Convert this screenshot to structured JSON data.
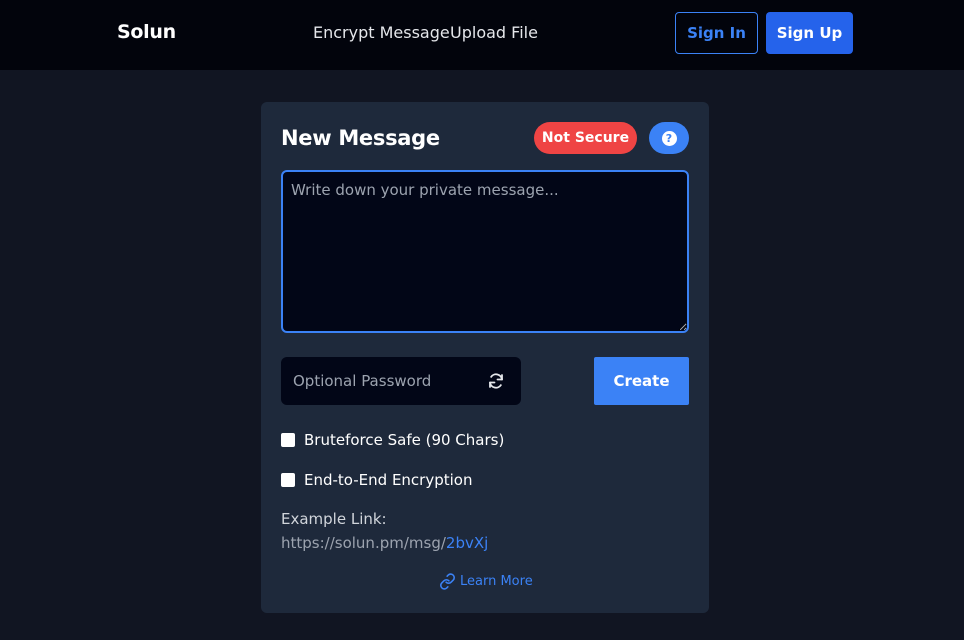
{
  "nav": {
    "brand": "Solun",
    "links": [
      "Encrypt Message",
      "Upload File"
    ],
    "signin_label": "Sign In",
    "signup_label": "Sign Up"
  },
  "card": {
    "title": "New Message",
    "security_badge": "Not Secure",
    "help_icon": "?",
    "message": {
      "value": "",
      "placeholder": "Write down your private message..."
    },
    "password": {
      "value": "",
      "placeholder": "Optional Password"
    },
    "create_label": "Create",
    "options": [
      {
        "label": "Bruteforce Safe (90 Chars)",
        "checked": false
      },
      {
        "label": "End-to-End Encryption",
        "checked": false
      }
    ],
    "example_label": "Example Link:",
    "example_url_base": "https://solun.pm/msg/",
    "example_url_slug": "2bvXj",
    "learn_more_label": "Learn More"
  },
  "colors": {
    "page_bg": "#111522",
    "nav_bg": "#02040c",
    "card_bg": "#1e293b",
    "accent": "#3b82f6",
    "signup_bg": "#2563eb",
    "danger": "#ef4444",
    "input_bg": "#020617"
  },
  "icons": [
    "question-icon",
    "refresh-icon",
    "link-icon"
  ]
}
